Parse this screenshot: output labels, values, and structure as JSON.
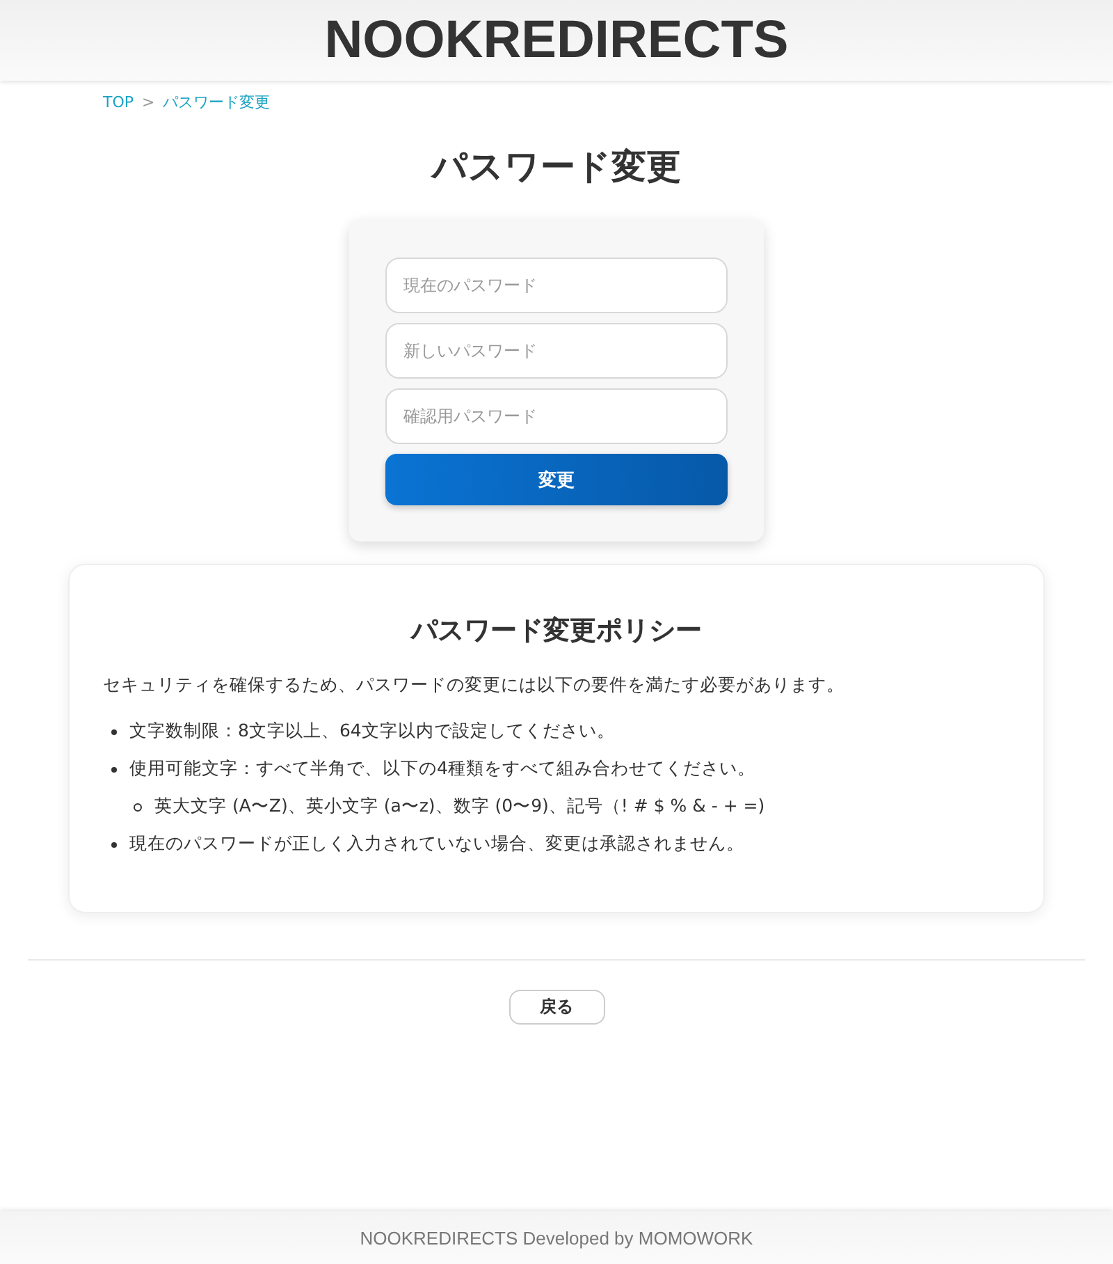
{
  "header": {
    "title": "NOOKREDIRECTS"
  },
  "breadcrumb": {
    "separator": ">",
    "items": [
      {
        "label": "TOP"
      },
      {
        "label": "パスワード変更"
      }
    ]
  },
  "page_title": "パスワード変更",
  "form": {
    "fields": [
      {
        "placeholder": "現在のパスワード"
      },
      {
        "placeholder": "新しいパスワード"
      },
      {
        "placeholder": "確認用パスワード"
      }
    ],
    "submit": "変更"
  },
  "policy": {
    "title": "パスワード変更ポリシー",
    "intro": "セキュリティを確保するため、パスワードの変更には以下の要件を満たす必要があります。",
    "items": [
      {
        "text": "文字数制限：8文字以上、64文字以内で設定してください。"
      },
      {
        "text": "使用可能文字：すべて半角で、以下の4種類をすべて組み合わせてください。",
        "children": [
          {
            "text": "英大文字 (A〜Z)、英小文字 (a〜z)、数字 (0〜9)、記号（! # $ % & - + =)"
          }
        ]
      },
      {
        "text": "現在のパスワードが正しく入力されていない場合、変更は承認されません。"
      }
    ]
  },
  "back_button": "戻る",
  "footer": "NOOKREDIRECTS Developed by MOMOWORK"
}
